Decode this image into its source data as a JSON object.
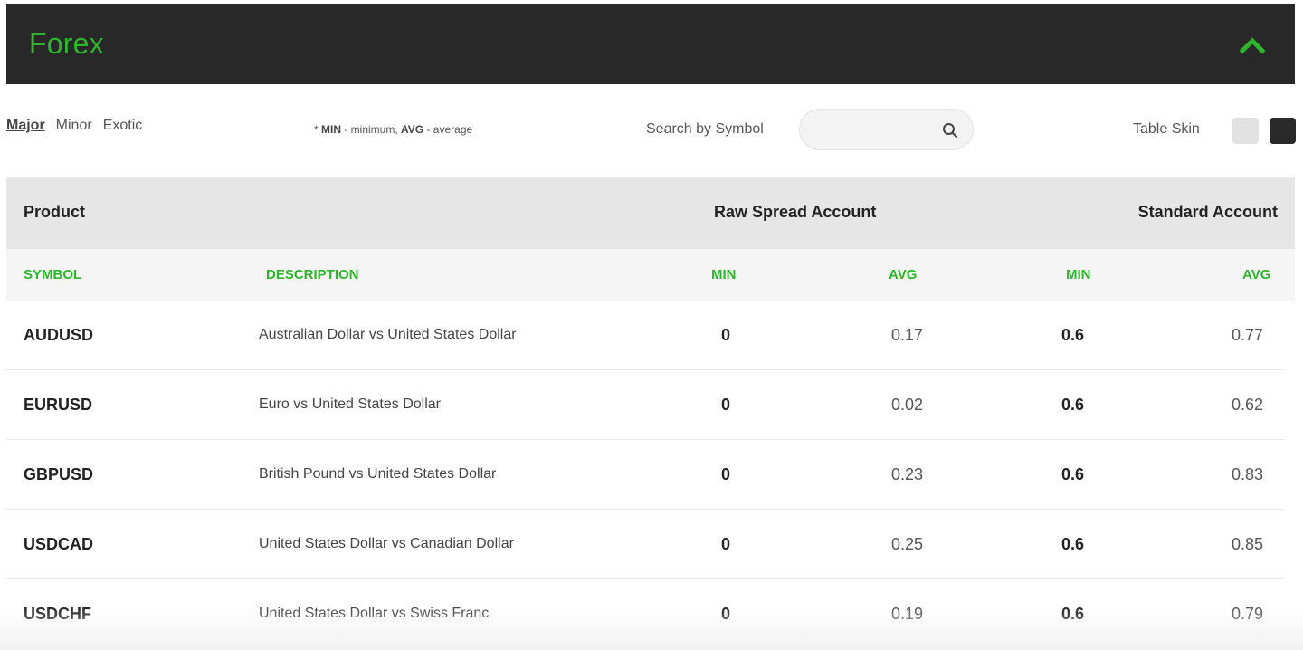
{
  "header": {
    "title": "Forex",
    "accent_color": "#2db52d",
    "background_color": "#282828",
    "collapse_icon": "chevron-up-icon"
  },
  "filters": {
    "tabs": [
      {
        "label": "Major",
        "active": true
      },
      {
        "label": "Minor",
        "active": false
      },
      {
        "label": "Exotic",
        "active": false
      }
    ]
  },
  "legend": {
    "prefix": "* ",
    "min_key": "MIN",
    "min_text": " - minimum, ",
    "avg_key": "AVG",
    "avg_text": " - average"
  },
  "search": {
    "label": "Search by Symbol",
    "value": "",
    "placeholder": "",
    "icon": "search-icon"
  },
  "skin": {
    "label": "Table Skin",
    "options": [
      {
        "name": "light",
        "color": "#e2e2e2"
      },
      {
        "name": "dark",
        "color": "#2a2a2a"
      }
    ]
  },
  "table": {
    "group_headers": {
      "product": "Product",
      "raw": "Raw Spread Account",
      "standard": "Standard Account"
    },
    "column_headers": {
      "symbol": "SYMBOL",
      "description": "DESCRIPTION",
      "raw_min": "MIN",
      "raw_avg": "AVG",
      "std_min": "MIN",
      "std_avg": "AVG"
    },
    "rows": [
      {
        "symbol": "AUDUSD",
        "description": "Australian Dollar vs United States Dollar",
        "raw_min": "0",
        "raw_avg": "0.17",
        "std_min": "0.6",
        "std_avg": "0.77"
      },
      {
        "symbol": "EURUSD",
        "description": "Euro vs United States Dollar",
        "raw_min": "0",
        "raw_avg": "0.02",
        "std_min": "0.6",
        "std_avg": "0.62"
      },
      {
        "symbol": "GBPUSD",
        "description": "British Pound vs United States Dollar",
        "raw_min": "0",
        "raw_avg": "0.23",
        "std_min": "0.6",
        "std_avg": "0.83"
      },
      {
        "symbol": "USDCAD",
        "description": "United States Dollar vs Canadian Dollar",
        "raw_min": "0",
        "raw_avg": "0.25",
        "std_min": "0.6",
        "std_avg": "0.85"
      },
      {
        "symbol": "USDCHF",
        "description": "United States Dollar vs Swiss Franc",
        "raw_min": "0",
        "raw_avg": "0.19",
        "std_min": "0.6",
        "std_avg": "0.79"
      }
    ]
  }
}
